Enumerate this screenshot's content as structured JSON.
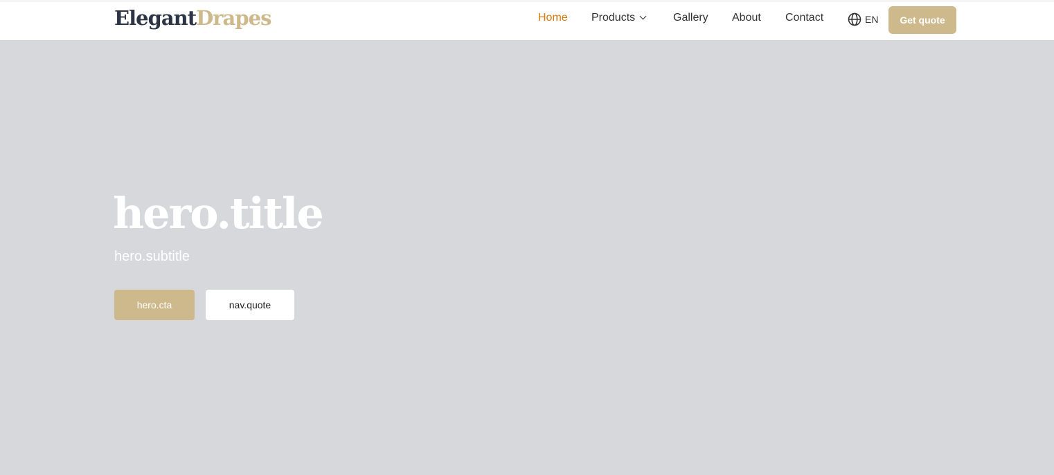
{
  "brand": {
    "part1": "Elegant",
    "part2": "Drapes"
  },
  "nav": {
    "items": [
      {
        "label": "Home",
        "active": true
      },
      {
        "label": "Products"
      },
      {
        "label": "Gallery"
      },
      {
        "label": "About"
      },
      {
        "label": "Contact"
      }
    ],
    "language": "EN",
    "quote_button": "Get quote"
  },
  "hero": {
    "title": "hero.title",
    "subtitle": "hero.subtitle",
    "cta": "hero.cta",
    "quote": "nav.quote"
  },
  "colors": {
    "accent": "#cdb98b",
    "active": "#d97706",
    "hero_bg": "#d7d8dc",
    "brand_dark": "#2c3445"
  }
}
